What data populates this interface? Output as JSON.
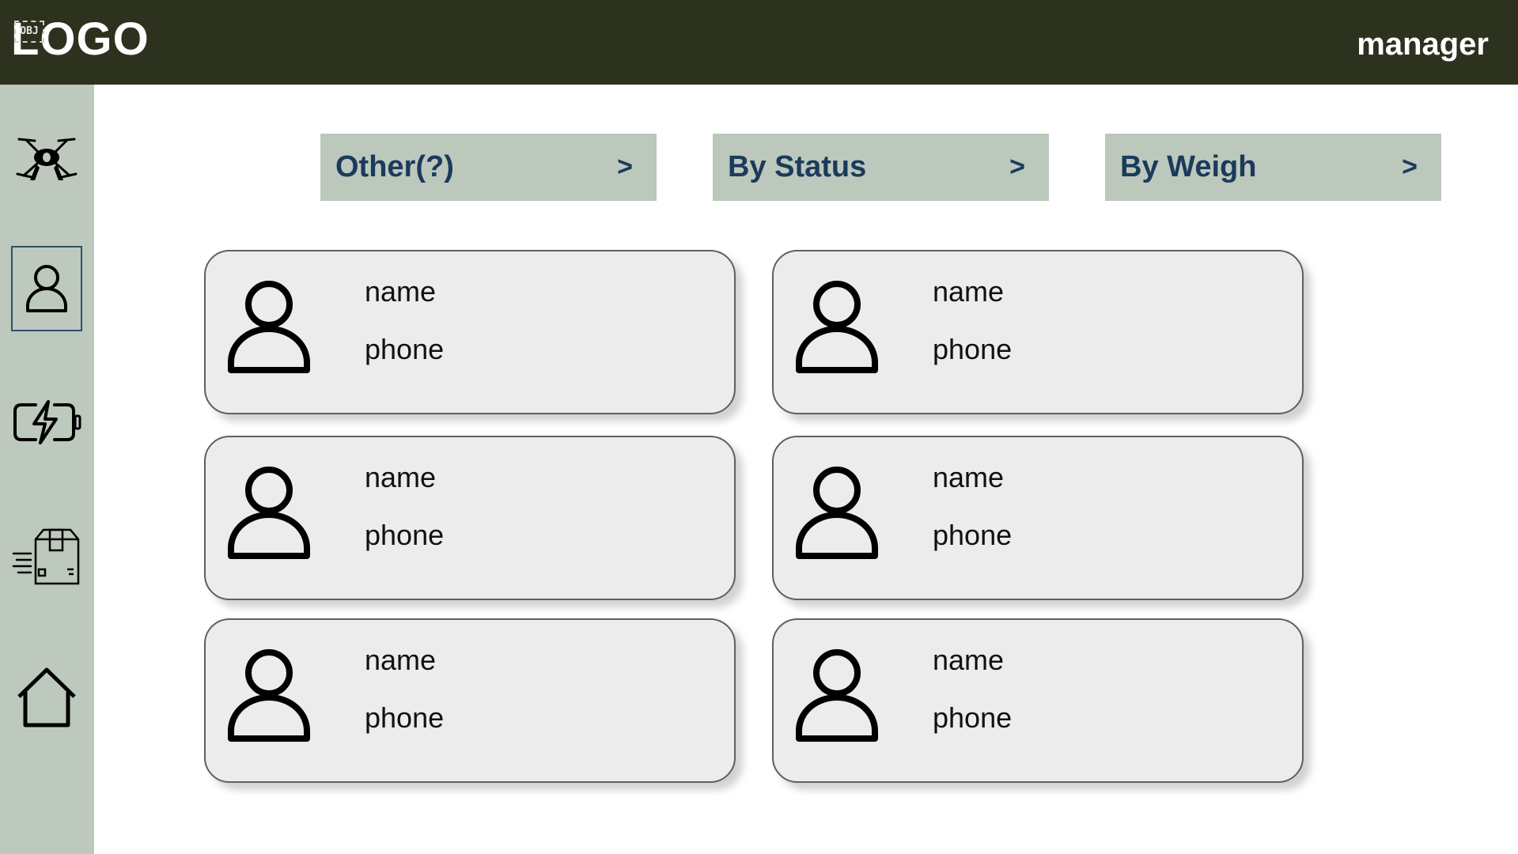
{
  "header": {
    "logo": "LOGO",
    "logo_placeholder": "OBJ",
    "role": "manager",
    "background": "#2d321f"
  },
  "sidebar": {
    "background": "#bdc9bc",
    "items": [
      {
        "icon": "drone-icon",
        "active": false
      },
      {
        "icon": "user-icon",
        "active": true
      },
      {
        "icon": "battery-charging-icon",
        "active": false
      },
      {
        "icon": "delivery-box-icon",
        "active": false
      },
      {
        "icon": "home-icon",
        "active": false
      }
    ]
  },
  "filters": [
    {
      "label": "Other(?)",
      "chevron": ">"
    },
    {
      "label": "By Status",
      "chevron": ">"
    },
    {
      "label": "By Weigh",
      "chevron": ">"
    }
  ],
  "cards": [
    {
      "name": "name",
      "phone": "phone"
    },
    {
      "name": "name",
      "phone": "phone"
    },
    {
      "name": "name",
      "phone": "phone"
    },
    {
      "name": "name",
      "phone": "phone"
    },
    {
      "name": "name",
      "phone": "phone"
    },
    {
      "name": "name",
      "phone": "phone"
    }
  ]
}
